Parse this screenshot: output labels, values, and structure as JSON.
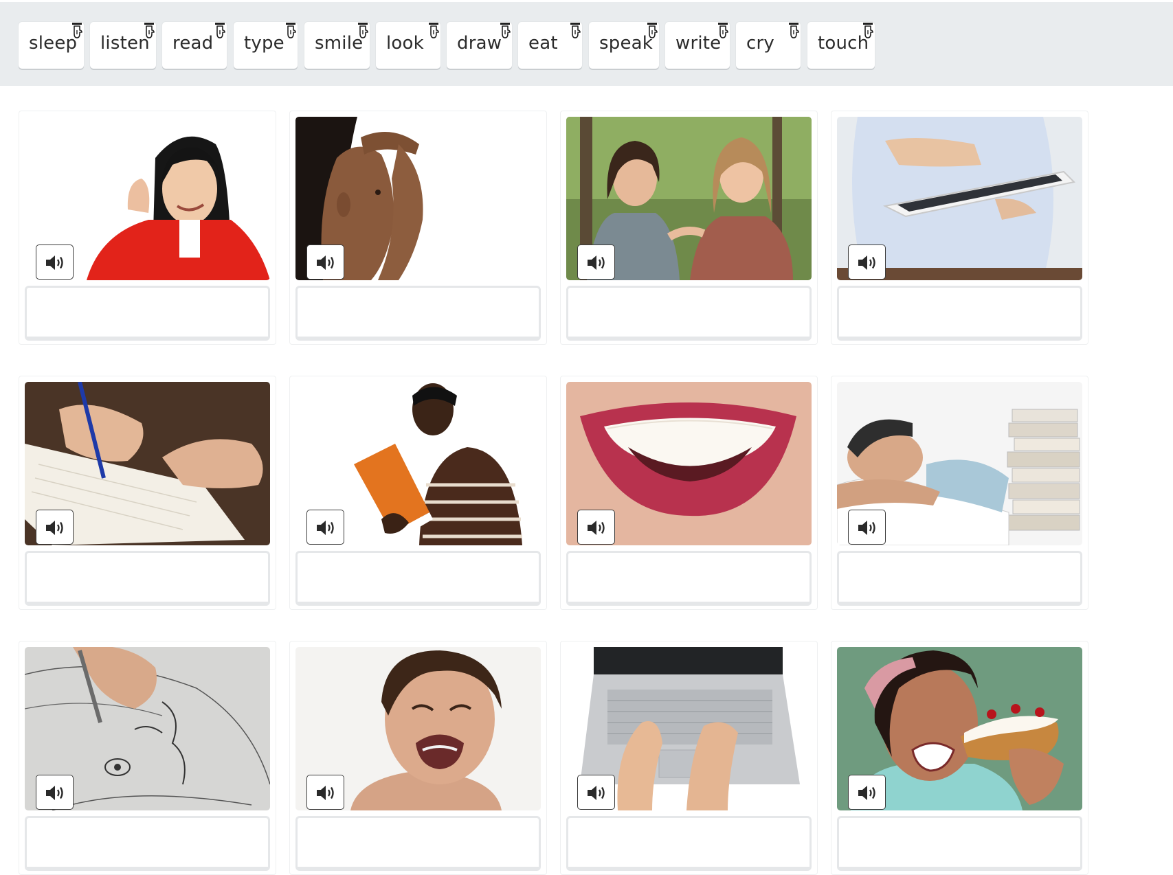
{
  "word_bank": [
    {
      "label": "sleep"
    },
    {
      "label": "listen"
    },
    {
      "label": "read"
    },
    {
      "label": "type"
    },
    {
      "label": "smile"
    },
    {
      "label": "look"
    },
    {
      "label": "draw"
    },
    {
      "label": "eat"
    },
    {
      "label": "speak"
    },
    {
      "label": "write"
    },
    {
      "label": "cry"
    },
    {
      "label": "touch"
    }
  ],
  "drag_icon": "hand-pointer-drag-icon",
  "audio_icon": "speaker-volume-icon",
  "cards": [
    {
      "image": "woman-listening-photo",
      "answer": ""
    },
    {
      "image": "girl-looking-photo",
      "answer": ""
    },
    {
      "image": "two-women-speaking-photo",
      "answer": ""
    },
    {
      "image": "hand-touching-tablet-photo",
      "answer": ""
    },
    {
      "image": "hand-writing-notebook-photo",
      "answer": ""
    },
    {
      "image": "man-reading-book-photo",
      "answer": ""
    },
    {
      "image": "smiling-mouth-photo",
      "answer": ""
    },
    {
      "image": "man-sleeping-on-books-photo",
      "answer": ""
    },
    {
      "image": "hand-drawing-sketch-photo",
      "answer": ""
    },
    {
      "image": "child-crying-photo",
      "answer": ""
    },
    {
      "image": "hands-typing-laptop-photo",
      "answer": ""
    },
    {
      "image": "woman-eating-cake-photo",
      "answer": ""
    }
  ]
}
